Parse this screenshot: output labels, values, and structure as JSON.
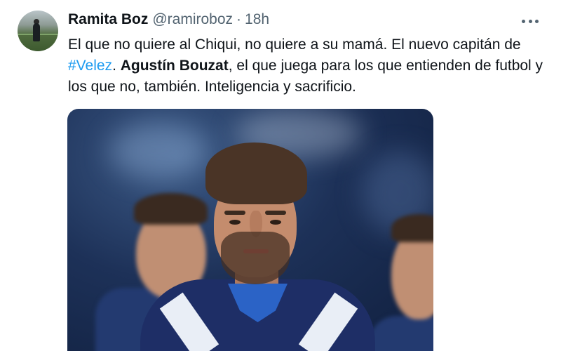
{
  "tweet": {
    "author": {
      "display_name": "Ramita Boz",
      "handle": "@ramiroboz",
      "separator": "·",
      "time": "18h"
    },
    "text": {
      "p1": "El que no quiere al Chiqui, no quiere a su mamá. El nuevo capitán de ",
      "hashtag": "#Velez",
      "p2": ". ",
      "bold_name": "Agustín Bouzat",
      "p3": ", el que juega para los que entienden de futbol y los que no, también. Inteligencia y sacrificio."
    },
    "icons": {
      "more": "more-horizontal-icon",
      "avatar": "avatar"
    },
    "colors": {
      "link": "#1d9bf0",
      "secondary_text": "#536471",
      "primary_text": "#0f1419"
    }
  }
}
